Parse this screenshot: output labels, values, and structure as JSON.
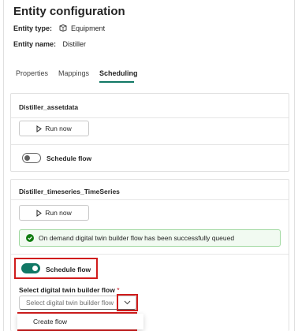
{
  "header": {
    "title": "Entity configuration",
    "entity_type_label": "Entity type:",
    "entity_type_value": "Equipment",
    "entity_name_label": "Entity name:",
    "entity_name_value": "Distiller"
  },
  "tabs": [
    {
      "label": "Properties",
      "active": false
    },
    {
      "label": "Mappings",
      "active": false
    },
    {
      "label": "Scheduling",
      "active": true
    }
  ],
  "cards": [
    {
      "title": "Distiller_assetdata",
      "run_label": "Run now",
      "schedule_label": "Schedule flow",
      "schedule_on": false
    },
    {
      "title": "Distiller_timeseries_TimeSeries",
      "run_label": "Run now",
      "success_message": "On demand digital twin builder flow has been successfully queued",
      "schedule_label": "Schedule flow",
      "schedule_on": true,
      "select_label": "Select digital twin builder flow",
      "select_required_mark": "*",
      "select_placeholder": "Select digital twin builder flow",
      "menu_item": "Create flow"
    }
  ],
  "colors": {
    "accent": "#117865",
    "highlight": "#d01c1c",
    "success_bg": "#f1faf1",
    "success_border": "#9fd89f"
  },
  "icons": [
    "equipment-icon",
    "play-icon",
    "check-circle-icon",
    "chevron-down-icon"
  ]
}
